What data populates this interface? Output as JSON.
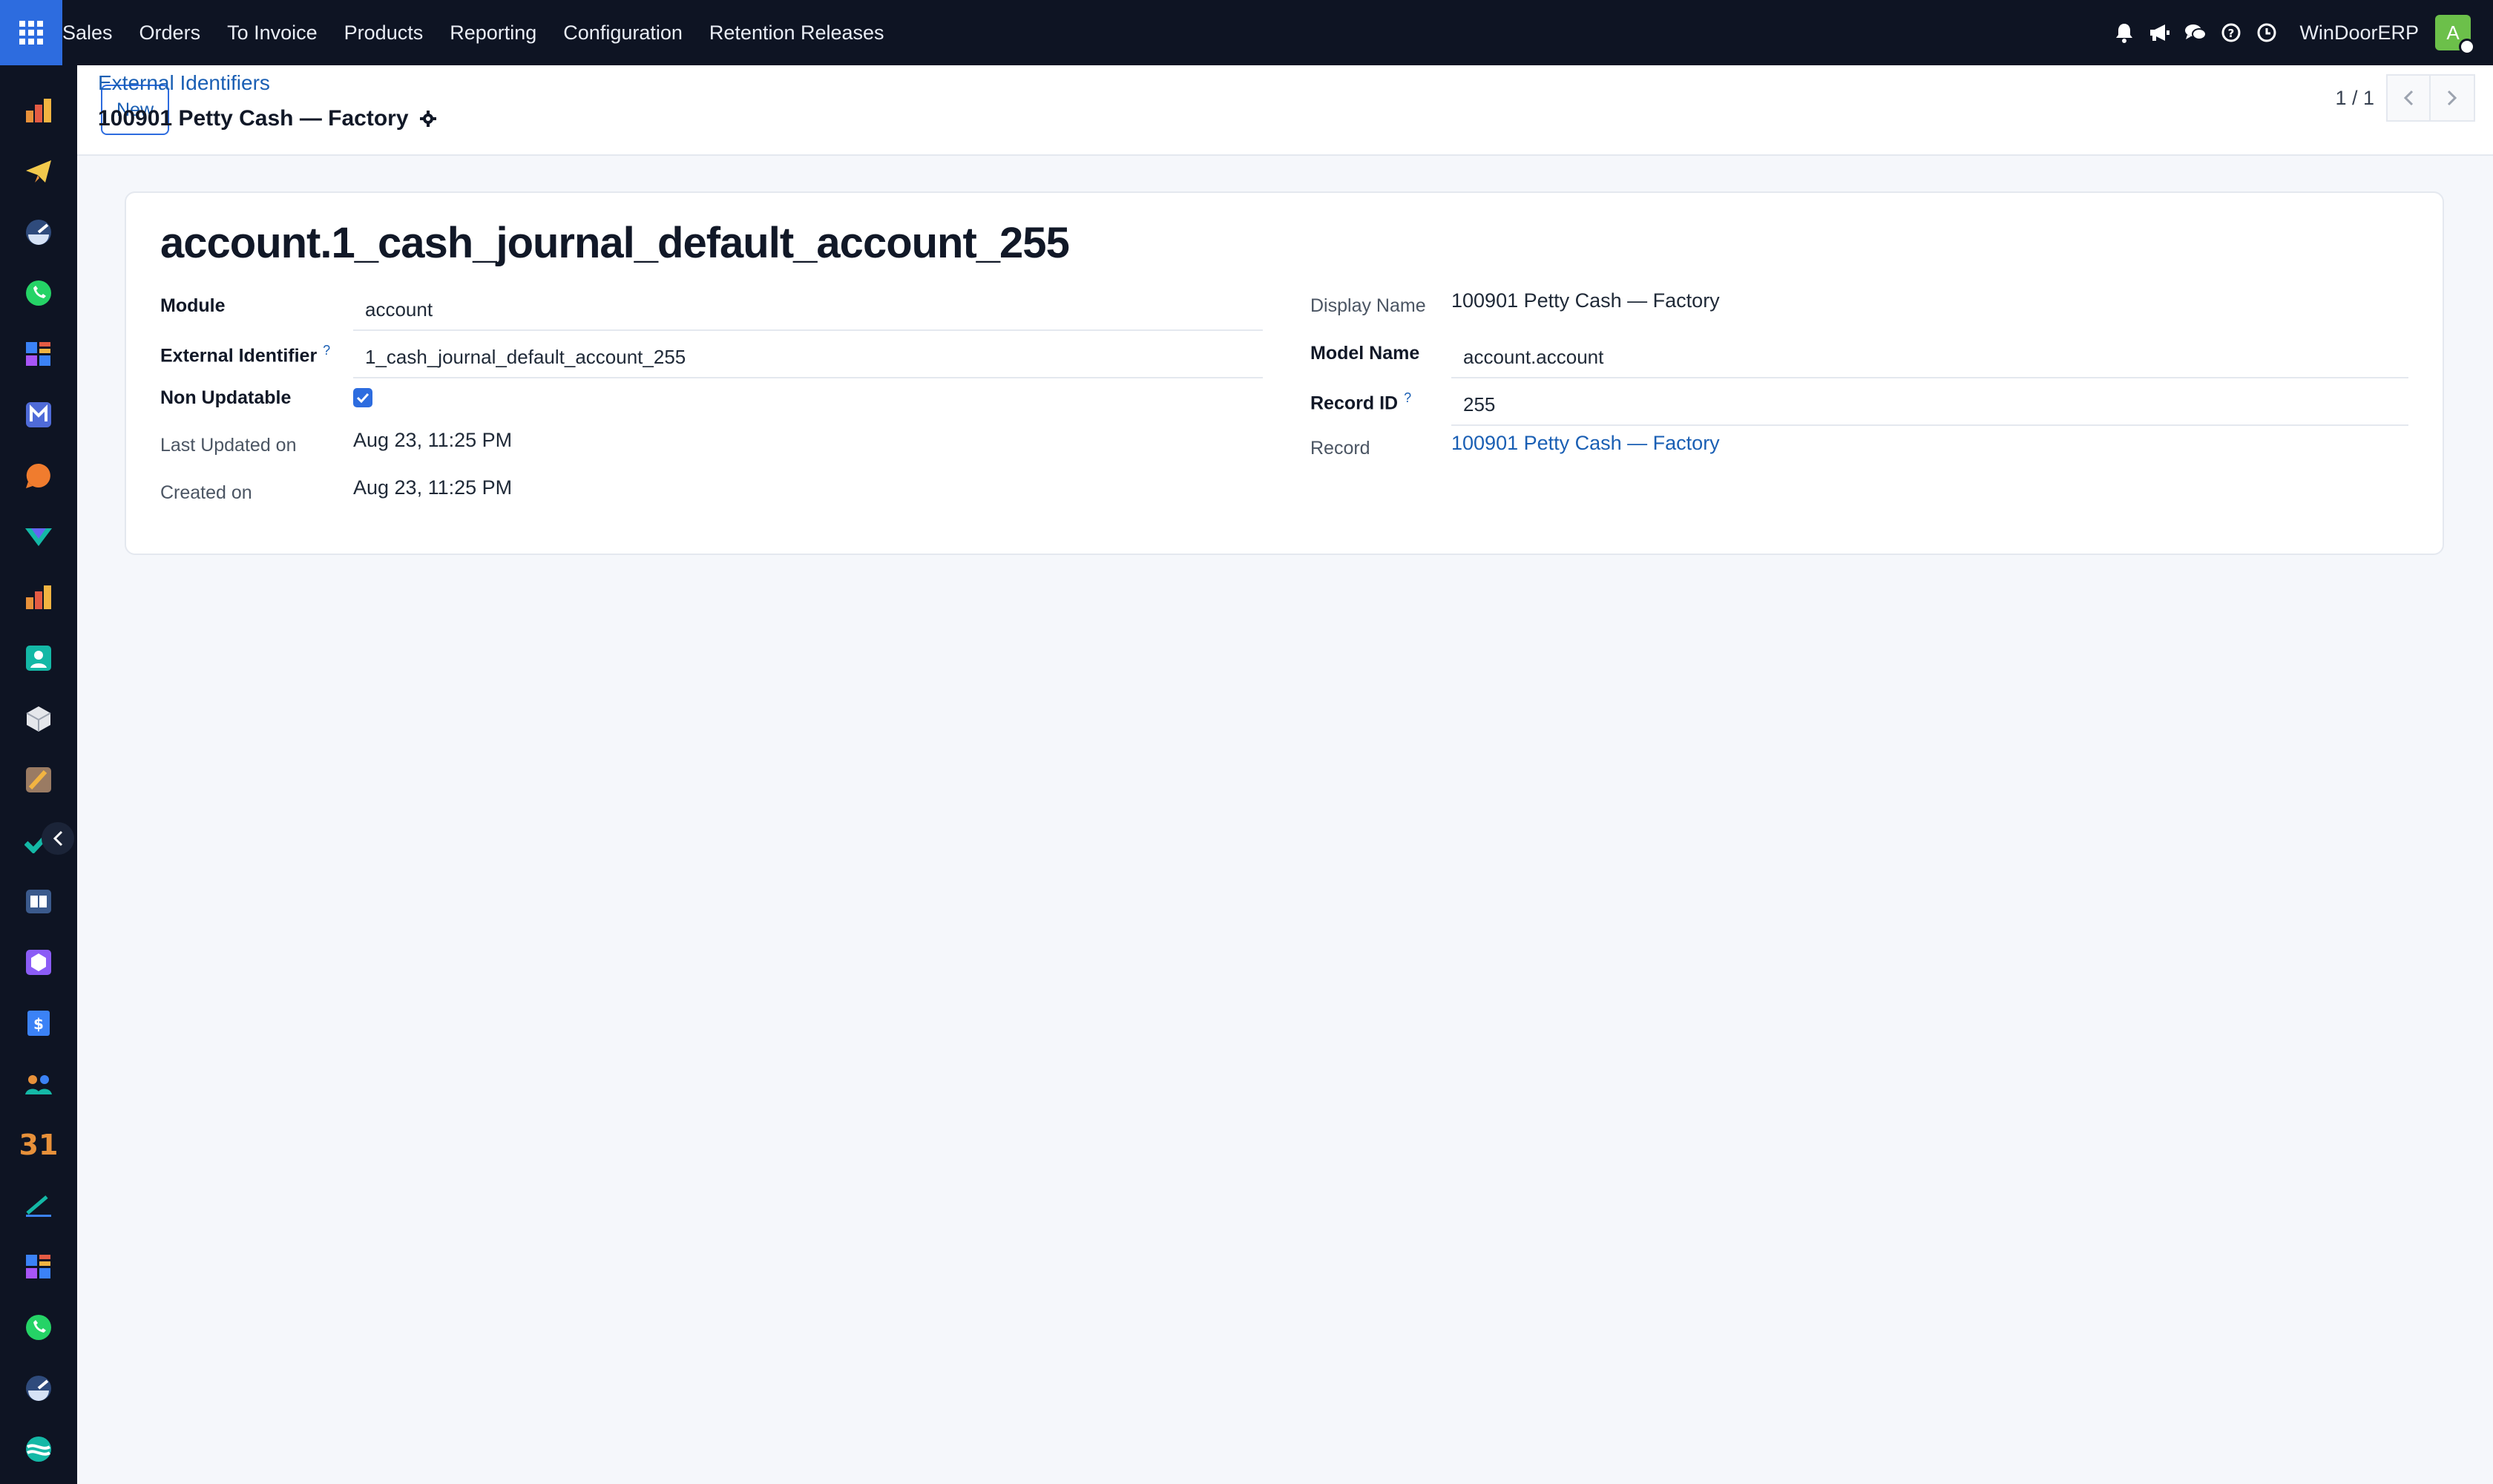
{
  "topbar": {
    "menu": [
      "Sales",
      "Orders",
      "To Invoice",
      "Products",
      "Reporting",
      "Configuration",
      "Retention Releases"
    ],
    "company": "WinDoorERP",
    "avatar_initial": "A",
    "icons": [
      "bell-icon",
      "megaphone-icon",
      "chat-icon",
      "help-icon",
      "clock-icon"
    ]
  },
  "sidebar": {
    "icons": [
      "sales-app-icon",
      "send-app-icon",
      "dashboard-app-icon",
      "whatsapp-app-icon",
      "studio-app-icon",
      "mail-app-icon",
      "livechat-app-icon",
      "project-app-icon",
      "reporting-app-icon",
      "contacts-app-icon",
      "inventory-app-icon",
      "marketing-app-icon",
      "planning-app-icon",
      "knowledge-app-icon",
      "repair-app-icon",
      "billing-app-icon",
      "team-app-icon",
      "calendar-app-icon",
      "sign-app-icon",
      "studio-app-icon-2",
      "whatsapp-app-icon-2",
      "dashboard-app-icon-2",
      "discuss-app-icon"
    ],
    "calendar_label": "31"
  },
  "control_panel": {
    "new_label": "New",
    "breadcrumb": "External Identifiers",
    "record_title": "100901 Petty Cash — Factory",
    "pager": "1 / 1"
  },
  "form": {
    "title": "account.1_cash_journal_default_account_255",
    "left": {
      "module_label": "Module",
      "module_value": "account",
      "external_id_label": "External Identifier",
      "external_id_help": "?",
      "external_id_value": "1_cash_journal_default_account_255",
      "non_updatable_label": "Non Updatable",
      "non_updatable_checked": true,
      "last_updated_label": "Last Updated on",
      "last_updated_value": "Aug 23, 11:25 PM",
      "created_label": "Created on",
      "created_value": "Aug 23, 11:25 PM"
    },
    "right": {
      "display_name_label": "Display Name",
      "display_name_value": "100901 Petty Cash — Factory",
      "model_name_label": "Model Name",
      "model_name_value": "account.account",
      "record_id_label": "Record ID",
      "record_id_help": "?",
      "record_id_value": "255",
      "record_label": "Record",
      "record_value": "100901 Petty Cash — Factory"
    }
  },
  "colors": {
    "navbar": "#0e1423",
    "accent": "#2d6cdf",
    "link": "#1a5fb4",
    "avatar": "#6cc04a"
  }
}
